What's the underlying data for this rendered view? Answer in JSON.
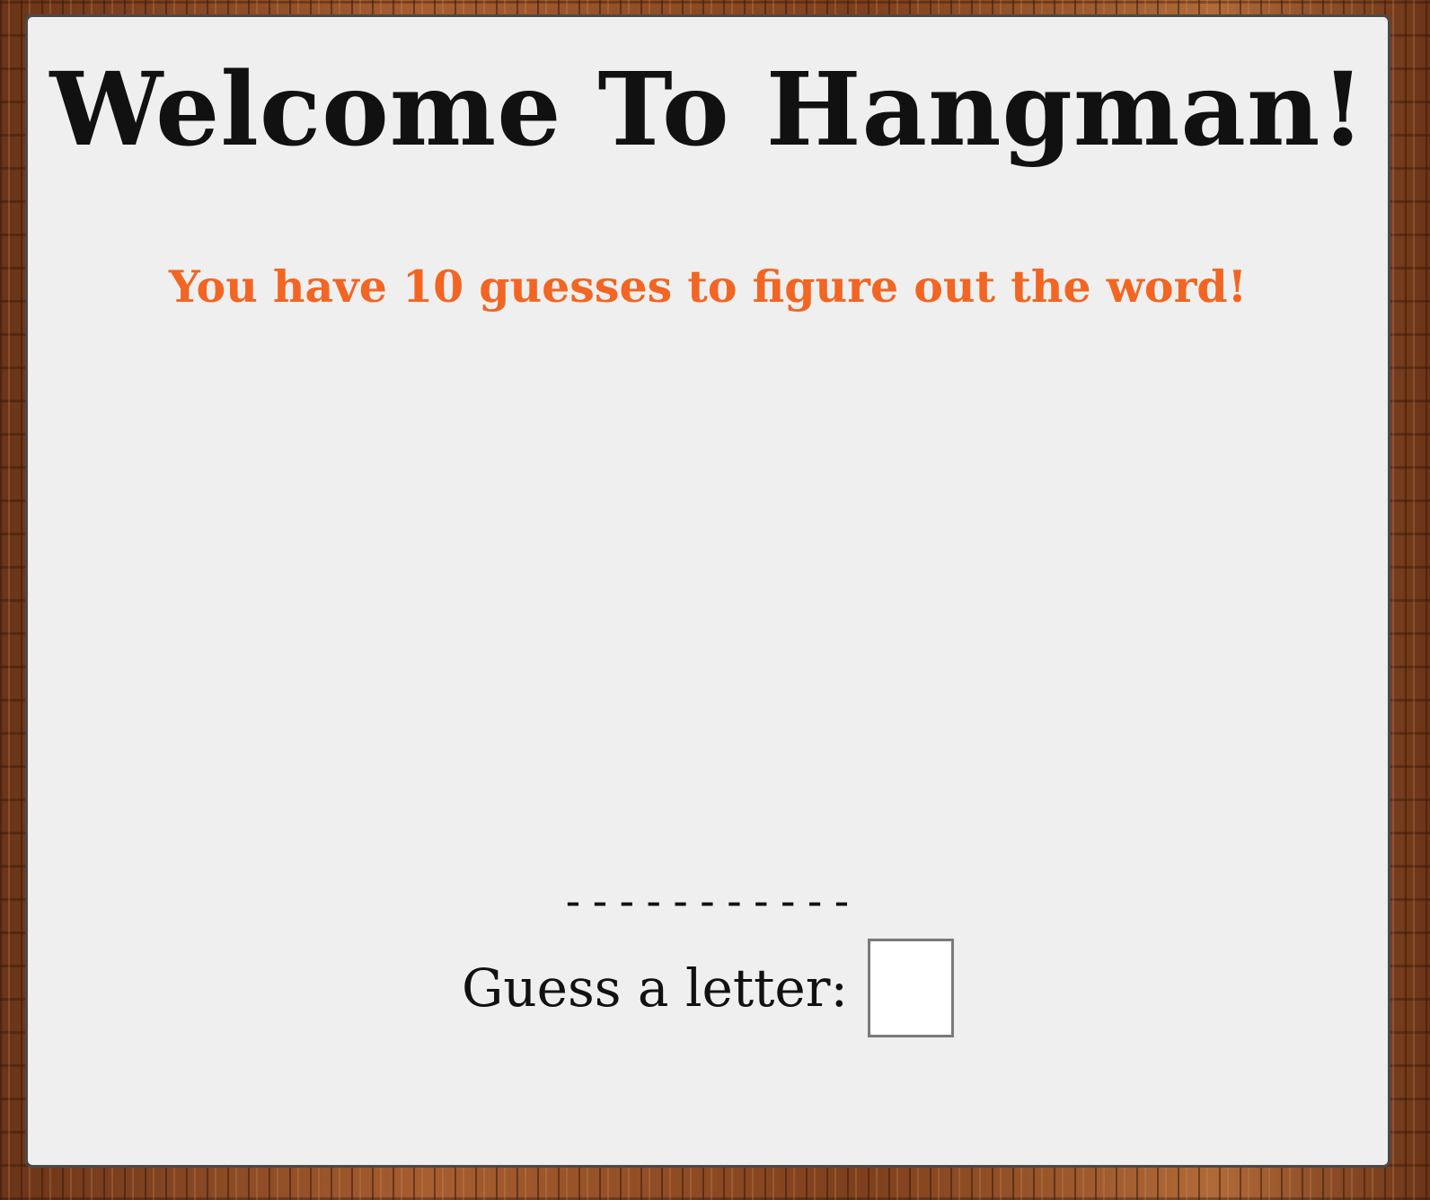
{
  "game": {
    "title": "Welcome To Hangman!",
    "instructions": "You have 10 guesses to figure out the word!",
    "word_display": "-----------",
    "guess_label": "Guess a letter:",
    "guess_value": ""
  },
  "colors": {
    "title": "#111111",
    "accent": "#f26522",
    "panel_background": "#efefef",
    "panel_border": "#4a4a4a"
  }
}
